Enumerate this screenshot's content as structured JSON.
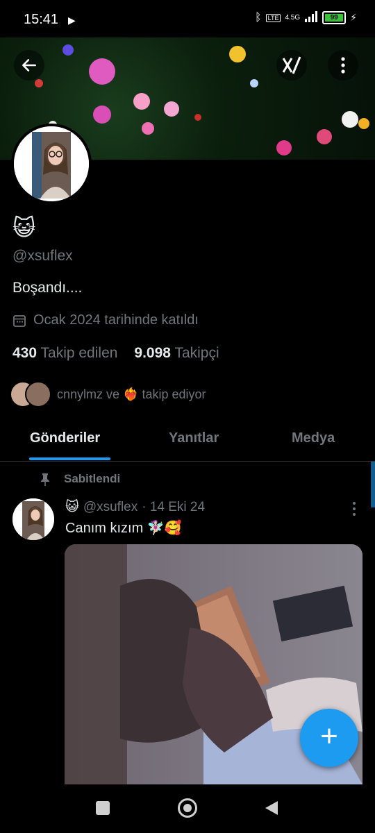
{
  "status_bar": {
    "time": "15:41",
    "network_label": "4.5G",
    "battery": "99",
    "battery_level": 0.99
  },
  "header": {
    "back_icon": "arrow-left-icon",
    "grok_icon": "grok-icon",
    "more_icon": "more-vertical-icon"
  },
  "profile": {
    "display_name": "😺",
    "handle": "@xsuflex",
    "bio": "Boşandı....",
    "joined": "Ocak 2024 tarihinde katıldı",
    "following_count": "430",
    "following_label": "Takip edilen",
    "followers_count": "9.098",
    "followers_label": "Takipçi",
    "followed_by": "cnnylmz ve ❤️‍🔥 takip ediyor"
  },
  "tabs": {
    "posts": "Gönderiler",
    "replies": "Yanıtlar",
    "media": "Medya",
    "active": "posts"
  },
  "post": {
    "pinned_label": "Sabitlendi",
    "author_name": "😺",
    "author_handle": "@xsuflex",
    "date": "· 14 Eki 24",
    "text": "Canım kızım 🧚🏻‍♀️🥰"
  },
  "colors": {
    "accent": "#1d9bf0",
    "muted": "#71767b",
    "text": "#e7e9ea",
    "background": "#000000"
  }
}
